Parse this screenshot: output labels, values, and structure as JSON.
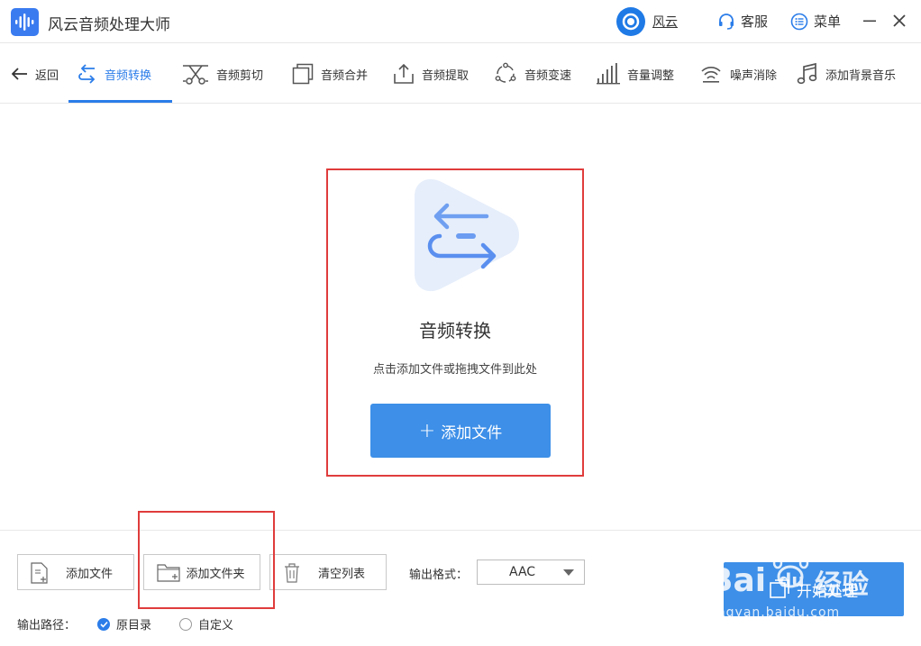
{
  "app": {
    "title": "风云音频处理大师",
    "user_name": "风云",
    "service_label": "客服",
    "menu_label": "菜单"
  },
  "toolbar": {
    "back_label": "返回",
    "items": [
      {
        "label": "音频转换",
        "icon": "convert-arrows-icon",
        "active": true
      },
      {
        "label": "音频剪切",
        "icon": "scissors-icon"
      },
      {
        "label": "音频合并",
        "icon": "merge-icon"
      },
      {
        "label": "音频提取",
        "icon": "export-icon"
      },
      {
        "label": "音频变速",
        "icon": "speed-icon"
      },
      {
        "label": "音量调整",
        "icon": "volume-bars-icon"
      },
      {
        "label": "噪声消除",
        "icon": "noise-wave-icon"
      },
      {
        "label": "添加背景音乐",
        "icon": "music-note-icon"
      }
    ]
  },
  "dropzone": {
    "title": "音频转换",
    "hint": "点击添加文件或拖拽文件到此处",
    "add_button": "添加文件"
  },
  "bottom": {
    "add_file": "添加文件",
    "add_folder": "添加文件夹",
    "clear_list": "清空列表",
    "format_label": "输出格式：",
    "format_value": "AAC",
    "start_label": "开始处理",
    "output_path_label": "输出路径：",
    "radio_original": "原目录",
    "radio_custom": "自定义",
    "selected_radio": "原目录"
  },
  "watermark": {
    "brand": "Bai",
    "brand2": "du",
    "cn": "经验",
    "url": "jingyan.baidu.com"
  },
  "colors": {
    "accent": "#2b7de9",
    "primary_button": "#3d8fe8",
    "highlight_box": "#e03c3c",
    "badge_bg": "#e6eefb"
  }
}
